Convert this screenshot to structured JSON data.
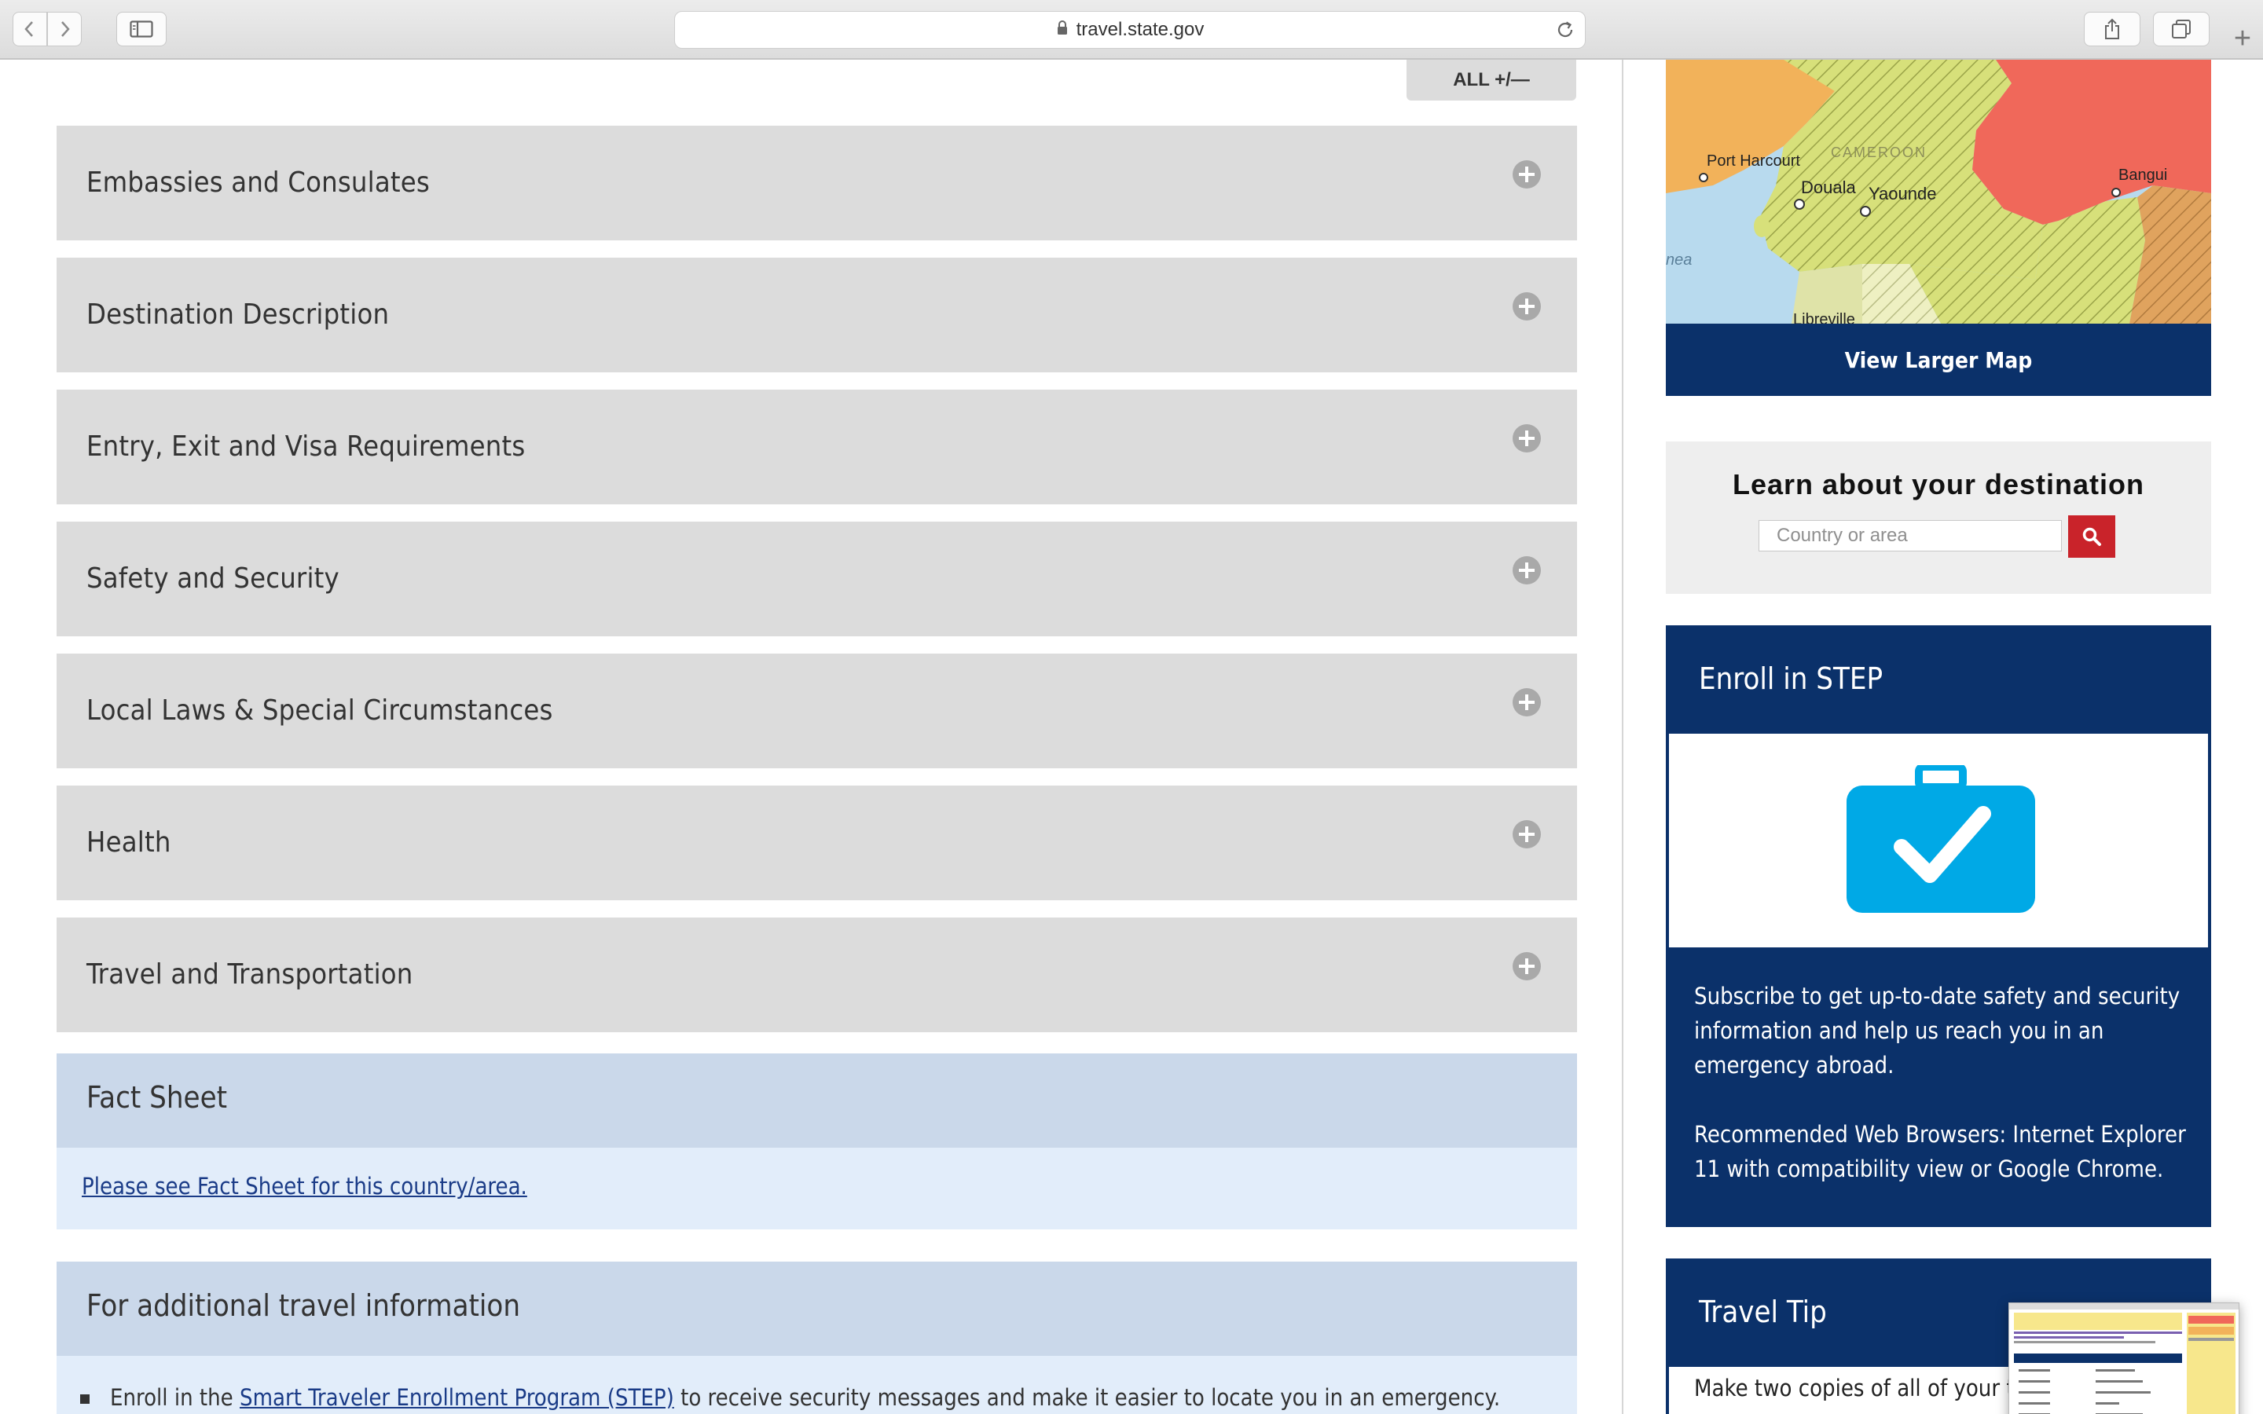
{
  "browser": {
    "url": "travel.state.gov",
    "new_tab_label": "+"
  },
  "page": {
    "all_toggle": "ALL +/—",
    "accordions": [
      {
        "title": "Embassies and Consulates"
      },
      {
        "title": "Destination Description"
      },
      {
        "title": "Entry, Exit and Visa Requirements"
      },
      {
        "title": "Safety and Security"
      },
      {
        "title": "Local Laws & Special Circumstances"
      },
      {
        "title": "Health"
      },
      {
        "title": "Travel and Transportation"
      }
    ],
    "fact_sheet": {
      "title": "Fact Sheet",
      "link": "Please see Fact Sheet for this country/area."
    },
    "additional": {
      "title": "For additional travel information",
      "item_prefix": "Enroll in the ",
      "item_link": "Smart Traveler Enrollment Program (STEP)",
      "item_suffix": " to receive security messages and make it easier to locate you in an emergency."
    }
  },
  "sidebar": {
    "map": {
      "labels": {
        "port_harcourt": "Port Harcourt",
        "cameroon": "CAMEROON",
        "douala": "Douala",
        "yaounde": "Yaounde",
        "bangui": "Bangui",
        "nea": "nea",
        "libreville": "Libreville"
      },
      "button": "View Larger Map"
    },
    "learn": {
      "title": "Learn about your destination",
      "placeholder": "Country or area"
    },
    "step": {
      "title": "Enroll in STEP",
      "text1": "Subscribe to get up-to-date safety and security information and help us reach you in an emergency abroad.",
      "text2": "Recommended Web Browsers: Internet Explorer 11 with compatibility view or Google Chrome."
    },
    "tip": {
      "title": "Travel Tip",
      "text": "Make two copies of all of your travel documents"
    }
  },
  "colors": {
    "navy": "#0b316a",
    "accordion_gray": "#dcdcdc",
    "fact_head": "#cad8ea",
    "fact_body": "#e2edfa",
    "search_red": "#c9232a",
    "step_blue": "#00a9e6"
  }
}
